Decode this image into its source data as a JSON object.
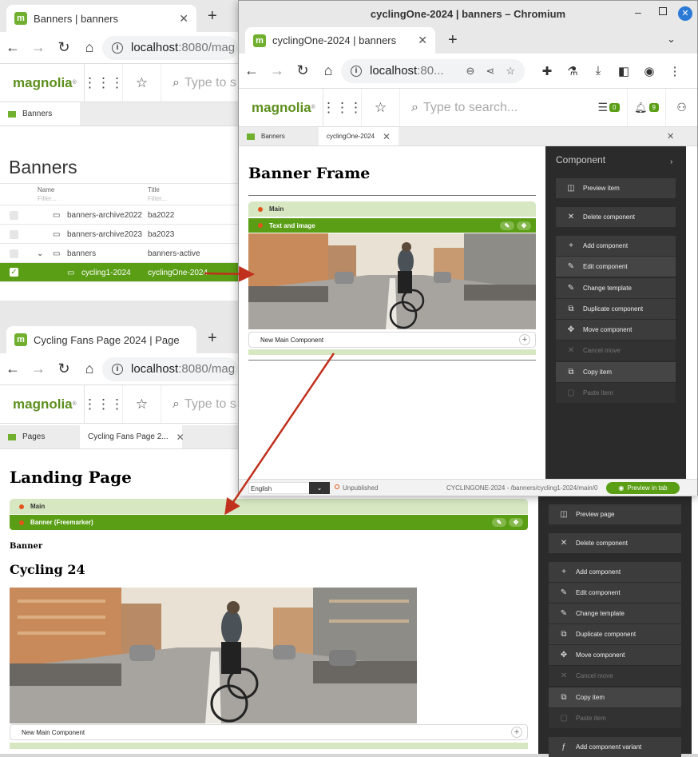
{
  "back_window_banners": {
    "tab_title": "Banners | banners",
    "url_host": "localhost",
    "url_path": ":8080/mag",
    "app_tab": "Banners",
    "search_placeholder": "Type to s",
    "heading": "Banners",
    "columns": [
      {
        "label": "Name",
        "filter": "Filter..."
      },
      {
        "label": "Title",
        "filter": "Filter..."
      }
    ],
    "rows": [
      {
        "name": "banners-archive2022",
        "title": "ba2022"
      },
      {
        "name": "banners-archive2023",
        "title": "ba2023"
      },
      {
        "name": "banners",
        "title": "banners-active"
      },
      {
        "name": "cycling1-2024",
        "title": "cyclingOne-2024"
      }
    ]
  },
  "front_window": {
    "window_title": "cyclingOne-2024 | banners – Chromium",
    "tab_title": "cyclingOne-2024 | banners",
    "url_host": "localhost",
    "url_path": ":80...",
    "search_placeholder": "Type to search...",
    "tasks_count": "0",
    "notifications_count": "9",
    "app_tabs": [
      "Banners",
      "cyclingOne-2024"
    ],
    "page_heading": "Banner Frame",
    "area_main": "Main",
    "component_bar": "Text and image",
    "new_component": "New Main Component",
    "panel_title": "Component",
    "actions": [
      "Preview item",
      "Delete component",
      "Add component",
      "Edit component",
      "Change template",
      "Duplicate component",
      "Move component",
      "Cancel move",
      "Copy item",
      "Paste item"
    ],
    "status": {
      "language": "English",
      "publish_state": "Unpublished",
      "path": "CYCLINGONE-2024 - /banners/cycling1-2024/main/0",
      "preview_button": "Preview in tab"
    }
  },
  "bottom_window_pages": {
    "tab_title": "Cycling Fans Page 2024 | Page",
    "url_host": "localhost",
    "url_path": ":8080/mag",
    "search_placeholder": "Type to s",
    "app_tabs": [
      "Pages",
      "Cycling Fans Page 2..."
    ],
    "page_heading": "Landing Page",
    "area_main": "Main",
    "component_bar": "Banner (Freemarker)",
    "banner_label": "Banner",
    "banner_title": "Cycling 24",
    "new_component": "New Main Component",
    "actions": [
      "Preview page",
      "Delete component",
      "Add component",
      "Edit component",
      "Change template",
      "Duplicate component",
      "Move component",
      "Cancel move",
      "Copy item",
      "Paste item",
      "Add component variant"
    ]
  },
  "logo_text": "magnolia",
  "colors": {
    "magnolia_green": "#5a9e16",
    "area_green": "#d6e7c2",
    "panel_dark": "#2b2b2b",
    "arrow_red": "#c0301c"
  }
}
